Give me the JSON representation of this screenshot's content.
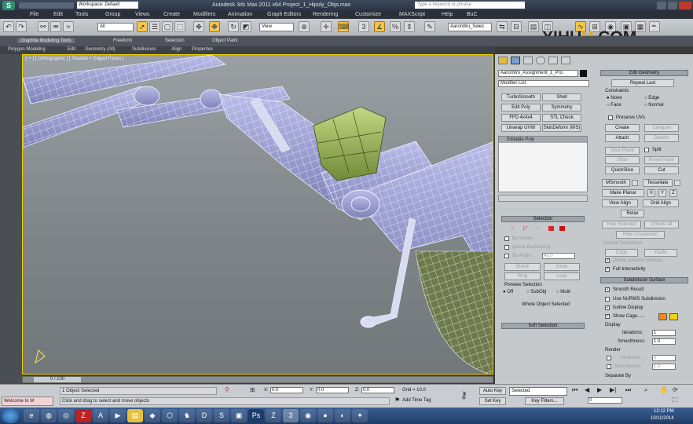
{
  "title_bar": {
    "workspace": "Workspace: Default",
    "title": "Autodesk 3ds Max 2011 x64     Project_1_Hipoly_Objs.max",
    "search_placeholder": "Type a keyword or phrase"
  },
  "menus": [
    "File",
    "Edit",
    "Tools",
    "Group",
    "Views",
    "Create",
    "Modifiers",
    "Animation",
    "Graph Editors",
    "Rendering",
    "Customize",
    "MAXScript",
    "Help",
    "BuC"
  ],
  "toolbar": {
    "selection_filter": "All",
    "coord_system": "View",
    "named_selection": "AaronWu_Selec"
  },
  "ribbon": {
    "tabs": [
      "Graphite Modeling Tools",
      "Freeform",
      "Selection",
      "Object Paint"
    ],
    "subtabs": [
      "Polygon Modeling",
      "Edit",
      "Geometry (All)",
      "Subdivision",
      "Align",
      "Properties"
    ]
  },
  "viewport": {
    "label": "[ + ] [ Orthographic ] [ Shaded + Edged Faces ]"
  },
  "command_panel": {
    "object_name": "AaronWu_Assignment_1_Pro",
    "modifier_list_label": "Modifier List",
    "modifier_buttons": [
      "TurboSmooth",
      "Shell",
      "Edit Poly",
      "Symmetry",
      "FFD 4x4x4",
      "STL Check",
      "Unwrap UVW",
      "SkinDeform (WS)"
    ],
    "stack_item": "Editable Poly",
    "selection": {
      "header": "Selection",
      "by_vertex": "By Vertex",
      "ignore_backfacing": "Ignore Backfacing",
      "by_angle": "By Angle:",
      "angle_value": "45.0",
      "shrink": "Shrink",
      "grow": "Grow",
      "ring": "Ring",
      "loop": "Loop",
      "preview_label": "Preview Selection",
      "preview_options": [
        "Off",
        "SubObj",
        "Multi"
      ],
      "whole_object": "Whole Object Selected"
    },
    "soft_selection": "Soft Selection"
  },
  "edit_geometry": {
    "header": "Edit Geometry",
    "repeat_last": "Repeat Last",
    "constraints_label": "Constraints",
    "constraints": [
      "None",
      "Edge",
      "Face",
      "Normal"
    ],
    "preserve_uvs": "Preserve UVs",
    "create": "Create",
    "collapse": "Collapse",
    "attach": "Attach",
    "detach": "Detach",
    "slice_plane": "Slice Plane",
    "split": "Split",
    "slice": "Slice",
    "reset_plane": "Reset Plane",
    "quickslice": "QuickSlice",
    "cut": "Cut",
    "msmooth": "MSmooth",
    "tessellate": "Tessellate",
    "make_planar": "Make Planar",
    "x": "X",
    "y": "Y",
    "z": "Z",
    "view_align": "View Align",
    "grid_align": "Grid Align",
    "relax": "Relax",
    "hide_selected": "Hide Selected",
    "unhide_all": "Unhide All",
    "hide_unselected": "Hide Unselected",
    "named_selections": "Named Selections:",
    "copy": "Copy",
    "paste": "Paste",
    "delete_isolated": "Delete Isolated Vertices",
    "full_interactivity": "Full Interactivity"
  },
  "subdivision_surface": {
    "header": "Subdivision Surface",
    "smooth_result": "Smooth Result",
    "use_nurms": "Use NURMS Subdivision",
    "isoline_display": "Isoline Display",
    "show_cage": "Show Cage......",
    "display_label": "Display",
    "iterations_label": "Iterations:",
    "iterations_value": "1",
    "smoothness_label": "Smoothness:",
    "smoothness_value": "1.0",
    "render_label": "Render",
    "render_iterations": "0",
    "render_smoothness": "1.0",
    "separate_by": "Separate By",
    "cage_colors": [
      "#f08a1c",
      "#f2d312"
    ]
  },
  "status": {
    "time_slider": "0 / 100",
    "objects_selected": "1 Object Selected",
    "prompt": "Click and drag to select and move objects",
    "x_label": "X:",
    "x_value": "0.0",
    "y_label": "Y:",
    "y_value": "0.0",
    "z_label": "Z:",
    "z_value": "0.0",
    "grid": "Grid = 10.0",
    "add_time_tag": "Add Time Tag",
    "auto_key": "Auto Key",
    "selected": "Selected",
    "set_key": "Set Key",
    "key_filters": "Key Filters...",
    "maxscript": "Welcome to M",
    "frame": "0"
  },
  "taskbar": {
    "time": "12:12 PM",
    "date": "10/11/2014",
    "apps": [
      "ie",
      "firefox",
      "chrome",
      "filezilla",
      "acrobat",
      "media",
      "stickies",
      "dropbox",
      "fusion",
      "chess",
      "dreamweaver",
      "skype",
      "player",
      "photoshop",
      "zbrush",
      "3dsmax",
      "maxcap",
      "obs",
      "recorder",
      "game"
    ]
  },
  "watermark": {
    "prefix": "YI",
    "mid": "HU",
    "y": "U",
    "suffix": ".COM"
  }
}
